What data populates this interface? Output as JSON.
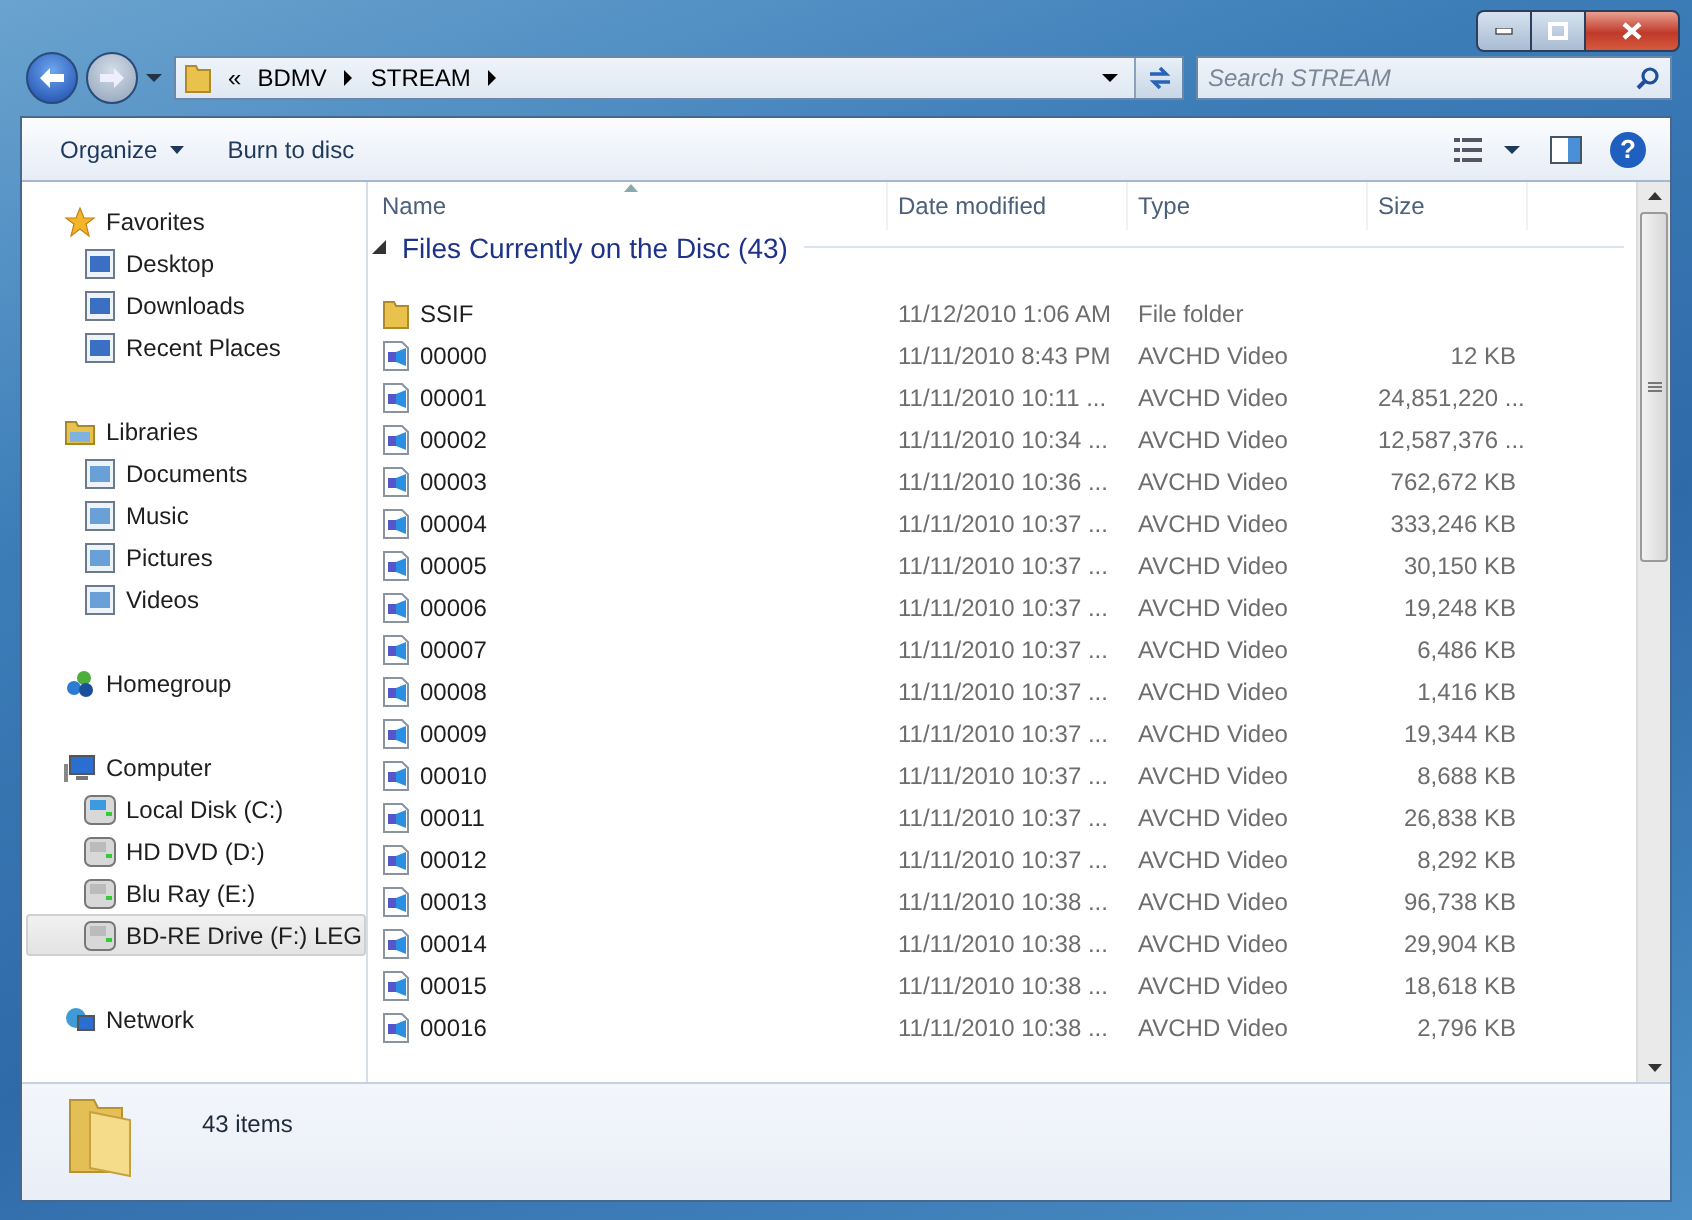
{
  "address": {
    "overflow": "«",
    "crumbs": [
      "BDMV",
      "STREAM"
    ]
  },
  "search": {
    "placeholder": "Search STREAM"
  },
  "toolbar": {
    "buttons": [
      "Organize",
      "Burn to disc"
    ],
    "help": "?"
  },
  "sidebar": {
    "groups": [
      {
        "label": "Favorites",
        "selected": false,
        "children": [
          {
            "label": "Desktop",
            "selected": false
          },
          {
            "label": "Downloads",
            "selected": false
          },
          {
            "label": "Recent Places",
            "selected": false
          }
        ]
      },
      {
        "label": "Libraries",
        "selected": false,
        "children": [
          {
            "label": "Documents",
            "selected": false
          },
          {
            "label": "Music",
            "selected": false
          },
          {
            "label": "Pictures",
            "selected": false
          },
          {
            "label": "Videos",
            "selected": false
          }
        ]
      },
      {
        "label": "Homegroup",
        "selected": false
      },
      {
        "label": "Computer",
        "selected": false,
        "children": [
          {
            "label": "Local Disk (C:)",
            "selected": false
          },
          {
            "label": "HD DVD (D:)",
            "selected": false
          },
          {
            "label": "Blu Ray (E:)",
            "selected": false
          },
          {
            "label": "BD-RE Drive (F:) LEG",
            "selected": true
          }
        ]
      },
      {
        "label": "Network",
        "selected": false
      }
    ]
  },
  "table": {
    "columns": [
      "Name",
      "Date modified",
      "Type",
      "Size"
    ],
    "group": {
      "label": "Files Currently on the Disc (43)",
      "expanded": true
    },
    "rows": [
      {
        "kind": "folder",
        "name": "SSIF",
        "date": "11/12/2010 1:06 AM",
        "type": "File folder",
        "size": ""
      },
      {
        "kind": "video",
        "name": "00000",
        "date": "11/11/2010 8:43 PM",
        "type": "AVCHD Video",
        "size": "12 KB"
      },
      {
        "kind": "video",
        "name": "00001",
        "date": "11/11/2010 10:11 ...",
        "type": "AVCHD Video",
        "size": "24,851,220 ..."
      },
      {
        "kind": "video",
        "name": "00002",
        "date": "11/11/2010 10:34 ...",
        "type": "AVCHD Video",
        "size": "12,587,376 ..."
      },
      {
        "kind": "video",
        "name": "00003",
        "date": "11/11/2010 10:36 ...",
        "type": "AVCHD Video",
        "size": "762,672 KB"
      },
      {
        "kind": "video",
        "name": "00004",
        "date": "11/11/2010 10:37 ...",
        "type": "AVCHD Video",
        "size": "333,246 KB"
      },
      {
        "kind": "video",
        "name": "00005",
        "date": "11/11/2010 10:37 ...",
        "type": "AVCHD Video",
        "size": "30,150 KB"
      },
      {
        "kind": "video",
        "name": "00006",
        "date": "11/11/2010 10:37 ...",
        "type": "AVCHD Video",
        "size": "19,248 KB"
      },
      {
        "kind": "video",
        "name": "00007",
        "date": "11/11/2010 10:37 ...",
        "type": "AVCHD Video",
        "size": "6,486 KB"
      },
      {
        "kind": "video",
        "name": "00008",
        "date": "11/11/2010 10:37 ...",
        "type": "AVCHD Video",
        "size": "1,416 KB"
      },
      {
        "kind": "video",
        "name": "00009",
        "date": "11/11/2010 10:37 ...",
        "type": "AVCHD Video",
        "size": "19,344 KB"
      },
      {
        "kind": "video",
        "name": "00010",
        "date": "11/11/2010 10:37 ...",
        "type": "AVCHD Video",
        "size": "8,688 KB"
      },
      {
        "kind": "video",
        "name": "00011",
        "date": "11/11/2010 10:37 ...",
        "type": "AVCHD Video",
        "size": "26,838 KB"
      },
      {
        "kind": "video",
        "name": "00012",
        "date": "11/11/2010 10:37 ...",
        "type": "AVCHD Video",
        "size": "8,292 KB"
      },
      {
        "kind": "video",
        "name": "00013",
        "date": "11/11/2010 10:38 ...",
        "type": "AVCHD Video",
        "size": "96,738 KB"
      },
      {
        "kind": "video",
        "name": "00014",
        "date": "11/11/2010 10:38 ...",
        "type": "AVCHD Video",
        "size": "29,904 KB"
      },
      {
        "kind": "video",
        "name": "00015",
        "date": "11/11/2010 10:38 ...",
        "type": "AVCHD Video",
        "size": "18,618 KB"
      },
      {
        "kind": "video",
        "name": "00016",
        "date": "11/11/2010 10:38 ...",
        "type": "AVCHD Video",
        "size": "2,796 KB"
      }
    ]
  },
  "status_bar": {
    "text": "43 items"
  }
}
